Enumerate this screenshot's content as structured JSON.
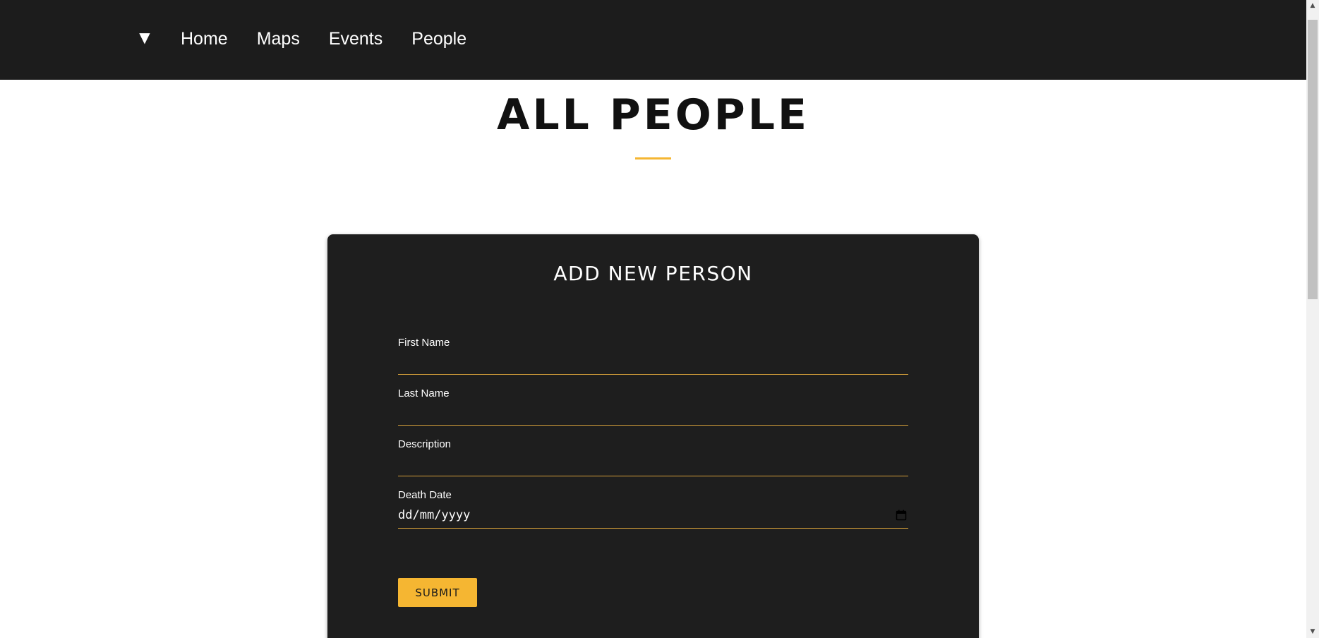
{
  "nav": {
    "toggle_glyph": "▼",
    "links": [
      {
        "label": "Home"
      },
      {
        "label": "Maps"
      },
      {
        "label": "Events"
      },
      {
        "label": "People"
      }
    ]
  },
  "page": {
    "title": "ALL PEOPLE"
  },
  "form": {
    "title": "ADD NEW PERSON",
    "fields": {
      "first_name": {
        "label": "First Name",
        "value": ""
      },
      "last_name": {
        "label": "Last Name",
        "value": ""
      },
      "description": {
        "label": "Description",
        "value": ""
      },
      "death_date": {
        "label": "Death Date",
        "placeholder": "dd/mm/yyyy"
      }
    },
    "submit_label": "SUBMIT"
  },
  "scrollbar": {
    "up_glyph": "▲",
    "down_glyph": "▼"
  },
  "colors": {
    "nav_background": "#1c1c1c",
    "card_background": "#1e1e1e",
    "accent": "#f5b632",
    "input_underline": "#d6a03a"
  }
}
